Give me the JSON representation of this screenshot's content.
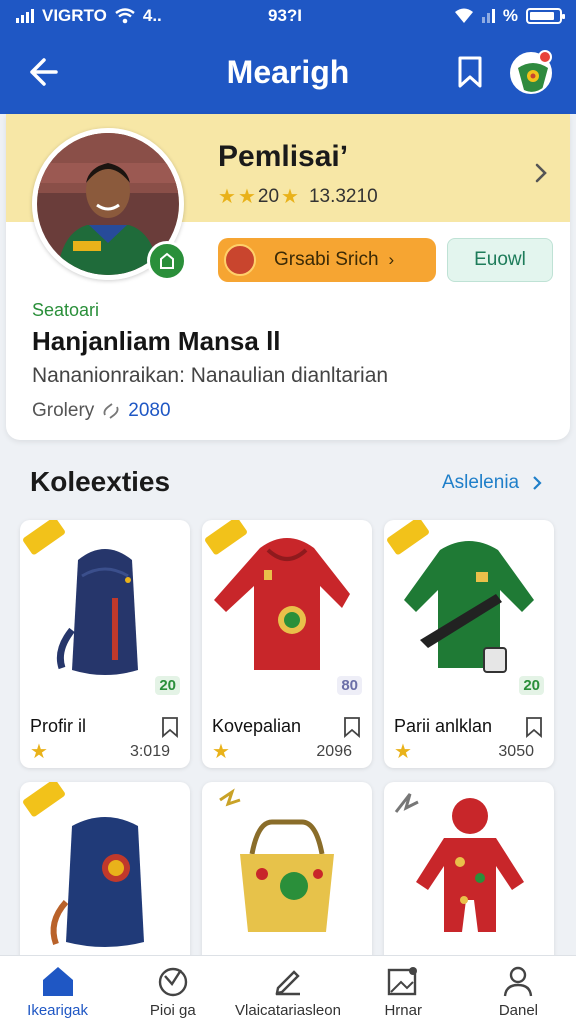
{
  "status_bar": {
    "carrier": "VIGRTO",
    "lte": "4..",
    "time": "93?I",
    "battery_pct": "%",
    "battery_level": 0.85
  },
  "app_bar": {
    "title": "Mearigh"
  },
  "profile": {
    "seller_name": "Pemlisaiʼ",
    "rating_text": "20",
    "rating_score": "13.3210",
    "primary_button": "Grsabi Srich",
    "secondary_button": "Euowl",
    "label": "Seatoari",
    "name": "Hanjanliam Mansa ll",
    "description": "Nananionraikan: Nanaulian dianltarian",
    "meta_label": "Grolery",
    "meta_value": "2080"
  },
  "section": {
    "title": "Koleexties",
    "see_all": "Aslelenia"
  },
  "products": [
    {
      "name": "Profir il",
      "price": "3:019",
      "percent": "20",
      "percent_color": "#2a8f3a"
    },
    {
      "name": "Kovepalian",
      "price": "2096",
      "percent": "80",
      "percent_color": "#6b6fa8"
    },
    {
      "name": "Parii anlklan",
      "price": "3050",
      "percent": "20",
      "percent_color": "#2a8f3a"
    }
  ],
  "nav": [
    {
      "label": "Ikearigak",
      "icon": "home-icon"
    },
    {
      "label": "Pioi ga",
      "icon": "tag-icon"
    },
    {
      "label": "Vlaicatariasleon",
      "icon": "edit-icon"
    },
    {
      "label": "Hrnar",
      "icon": "image-icon"
    },
    {
      "label": "Danel",
      "icon": "person-icon"
    }
  ],
  "colors": {
    "primary": "#1f57c4",
    "accent": "#f6a532",
    "banner": "#f7e7a6",
    "green": "#2a8f3a"
  }
}
